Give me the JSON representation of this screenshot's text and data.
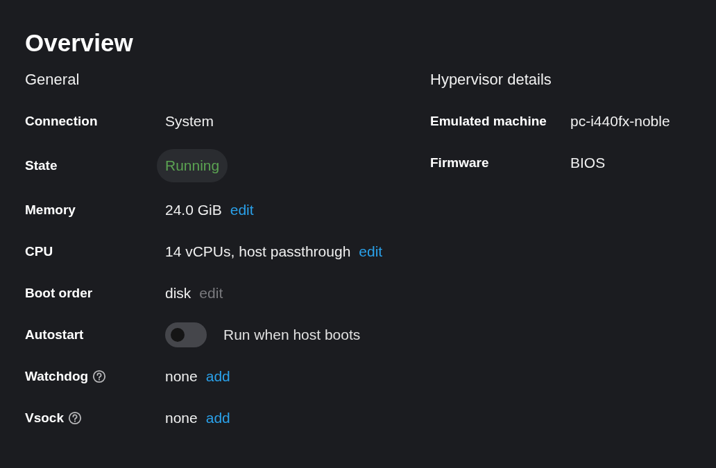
{
  "title": "Overview",
  "general": {
    "heading": "General",
    "rows": [
      {
        "label": "Connection",
        "kind": "text",
        "value": "System"
      },
      {
        "label": "State",
        "kind": "badge",
        "value": "Running"
      },
      {
        "label": "Memory",
        "kind": "text",
        "value": "24.0 GiB",
        "action": {
          "label": "edit",
          "disabled": false
        }
      },
      {
        "label": "CPU",
        "kind": "text",
        "value": "14 vCPUs, host passthrough",
        "action": {
          "label": "edit",
          "disabled": false
        }
      },
      {
        "label": "Boot order",
        "kind": "text",
        "value": "disk",
        "action": {
          "label": "edit",
          "disabled": true
        }
      },
      {
        "label": "Autostart",
        "kind": "toggle",
        "on": false,
        "value": "Run when host boots"
      },
      {
        "label": "Watchdog",
        "help": true,
        "kind": "text",
        "value": "none",
        "action": {
          "label": "add",
          "disabled": false
        }
      },
      {
        "label": "Vsock",
        "help": true,
        "kind": "text",
        "value": "none",
        "action": {
          "label": "add",
          "disabled": false
        }
      }
    ]
  },
  "hypervisor": {
    "heading": "Hypervisor details",
    "rows": [
      {
        "label": "Emulated machine",
        "kind": "text",
        "value": "pc-i440fx-noble"
      },
      {
        "label": "Firmware",
        "kind": "text",
        "value": "BIOS"
      }
    ]
  }
}
